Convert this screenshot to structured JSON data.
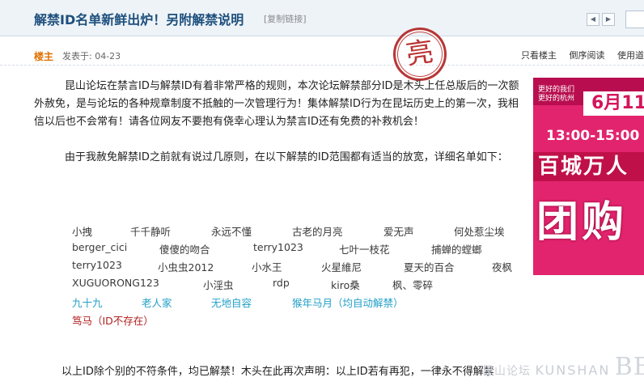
{
  "header": {
    "title": "解禁ID名单新鲜出炉！另附解禁说明",
    "copy_link": "[复制链接]",
    "prev_icon": "◀",
    "next_icon": "▶"
  },
  "post_bar": {
    "op_label": "楼主",
    "posted_at": "发表于: 04-23",
    "links": [
      "只看楼主",
      "倒序阅读",
      "使用道"
    ]
  },
  "stamp_text": "亮",
  "paragraphs": {
    "p1": "昆山论坛在禁言ID与解禁ID有着非常严格的规则，本次论坛解禁部分ID是木头上任总版后的一次额外赦免，是与论坛的各种规章制度不抵触的一次管理行为！集体解禁ID行为在昆坛历史上的第一次，我相信以后也不会常有！请各位网友不要抱有侥幸心理认为禁言ID还有免费的补救机会！",
    "p2": "由于我赦免解禁ID之前就有说过几原则，在以下解禁的ID范围都有适当的放宽，详细名单如下：",
    "p3": "以上ID除个别的不符条件，均已解禁！木头在此再次声明：以上ID若有再犯，一律永不得解禁"
  },
  "id_rows": [
    [
      "小拽",
      "千千静听",
      "永远不懂",
      "古老的月亮",
      "爱无声",
      "何处惹尘埃"
    ],
    [
      "berger_cici",
      "傻傻的吻合",
      "terry1023",
      "七叶一枝花",
      "捕蝉的螳螂"
    ],
    [
      "terry1023",
      "小虫虫2012",
      "小水王",
      "火星維尼",
      "夏天的百合",
      "夜枫"
    ],
    [
      "XUGUORONG123",
      "小淫虫",
      "rdp",
      "kiro桑",
      "枫、零碎"
    ],
    [
      "九十九",
      "老人家",
      "无地自容",
      "猴年马月（均自动解禁）"
    ],
    [
      "笃马（ID不存在）"
    ]
  ],
  "ad": {
    "small_text": "更好的我们\n更好的杭州",
    "date": "6月11",
    "time": "13:00-15:00",
    "big_text": "百城万人",
    "huge_text": "团购"
  },
  "watermark": {
    "cn": "昆山论坛",
    "en": "KUNSHAN",
    "bbs": "BBS"
  },
  "colors": {
    "title": "#1d4f7c",
    "op": "#e07000",
    "teal_ids": "#22a0c8",
    "red_ids": "#b32020",
    "stamp": "#b02222",
    "ad_bg": "#e2246e"
  }
}
